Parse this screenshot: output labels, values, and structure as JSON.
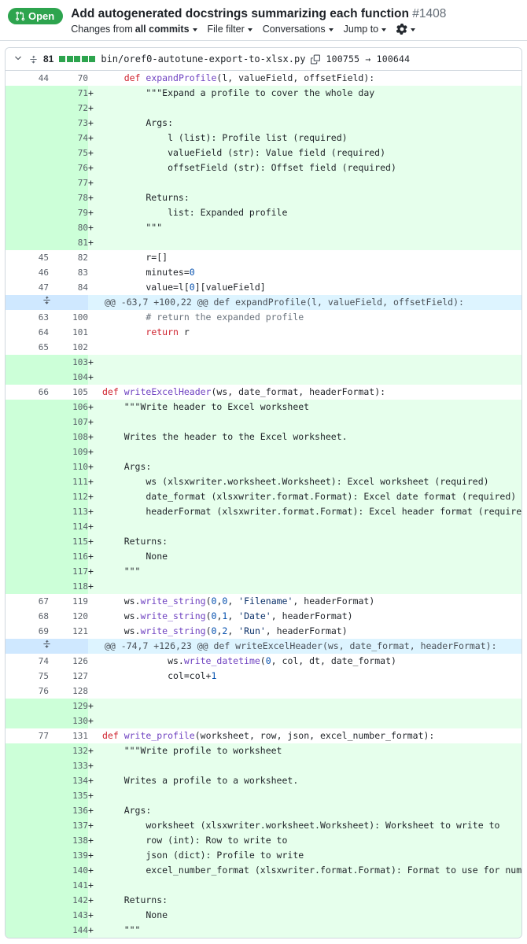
{
  "header": {
    "state_label": "Open",
    "state_icon": "pull-request-icon",
    "state_color": "#2da44e",
    "title": "Add autogenerated docstrings summarizing each function",
    "pr_number": "#1408",
    "toolbar": [
      {
        "label_prefix": "Changes from ",
        "label_strong": "all commits",
        "name": "changes-from-menu"
      },
      {
        "label_prefix": "File filter",
        "label_strong": "",
        "name": "file-filter-menu"
      },
      {
        "label_prefix": "Conversations",
        "label_strong": "",
        "name": "conversations-menu"
      },
      {
        "label_prefix": "Jump to",
        "label_strong": "",
        "name": "jump-to-menu"
      }
    ],
    "settings_icon": "gear-icon"
  },
  "file": {
    "collapse_icon": "chevron-down-icon",
    "expand_icon": "unfold-icon",
    "changes_count": "81",
    "diffstat_blocks": [
      "add",
      "add",
      "add",
      "add",
      "add"
    ],
    "path": "bin/oref0-autotune-export-to-xlsx.py",
    "copy_icon": "copy-icon",
    "mode_change": "100755 → 100644"
  },
  "colors": {
    "addition_bg": "#e6ffec",
    "addition_gutter": "#ccffd8",
    "hunk_bg": "#ddf4ff",
    "hunk_gutter": "#cfe8ff",
    "keyword": "#cf222e",
    "function": "#6f42c1",
    "number": "#0550ae",
    "string": "#0a3069",
    "comment": "#6a737d"
  },
  "diff_rows": [
    {
      "type": "ctx",
      "old": "44",
      "new": "70",
      "mark": "",
      "tokens": [
        {
          "t": "    ",
          "c": ""
        },
        {
          "t": "def ",
          "c": "k"
        },
        {
          "t": "expandProfile",
          "c": "fn"
        },
        {
          "t": "(l, valueField, offsetField):",
          "c": ""
        }
      ]
    },
    {
      "type": "add",
      "old": "",
      "new": "71",
      "mark": "+",
      "tokens": [
        {
          "t": "        \"\"\"Expand a profile to cover the whole day",
          "c": ""
        }
      ]
    },
    {
      "type": "add",
      "old": "",
      "new": "72",
      "mark": "+",
      "tokens": [
        {
          "t": "",
          "c": ""
        }
      ]
    },
    {
      "type": "add",
      "old": "",
      "new": "73",
      "mark": "+",
      "tokens": [
        {
          "t": "        Args:",
          "c": ""
        }
      ]
    },
    {
      "type": "add",
      "old": "",
      "new": "74",
      "mark": "+",
      "tokens": [
        {
          "t": "            l (list): Profile list (required)",
          "c": ""
        }
      ]
    },
    {
      "type": "add",
      "old": "",
      "new": "75",
      "mark": "+",
      "tokens": [
        {
          "t": "            valueField (str): Value field (required)",
          "c": ""
        }
      ]
    },
    {
      "type": "add",
      "old": "",
      "new": "76",
      "mark": "+",
      "tokens": [
        {
          "t": "            offsetField (str): Offset field (required)",
          "c": ""
        }
      ]
    },
    {
      "type": "add",
      "old": "",
      "new": "77",
      "mark": "+",
      "tokens": [
        {
          "t": "",
          "c": ""
        }
      ]
    },
    {
      "type": "add",
      "old": "",
      "new": "78",
      "mark": "+",
      "tokens": [
        {
          "t": "        Returns:",
          "c": ""
        }
      ]
    },
    {
      "type": "add",
      "old": "",
      "new": "79",
      "mark": "+",
      "tokens": [
        {
          "t": "            list: Expanded profile",
          "c": ""
        }
      ]
    },
    {
      "type": "add",
      "old": "",
      "new": "80",
      "mark": "+",
      "tokens": [
        {
          "t": "        \"\"\"",
          "c": ""
        }
      ]
    },
    {
      "type": "add",
      "old": "",
      "new": "81",
      "mark": "+",
      "tokens": [
        {
          "t": "",
          "c": ""
        }
      ]
    },
    {
      "type": "ctx",
      "old": "45",
      "new": "82",
      "mark": "",
      "tokens": [
        {
          "t": "        r=[]",
          "c": ""
        }
      ]
    },
    {
      "type": "ctx",
      "old": "46",
      "new": "83",
      "mark": "",
      "tokens": [
        {
          "t": "        minutes=",
          "c": ""
        },
        {
          "t": "0",
          "c": "n"
        }
      ]
    },
    {
      "type": "ctx",
      "old": "47",
      "new": "84",
      "mark": "",
      "tokens": [
        {
          "t": "        value=l[",
          "c": ""
        },
        {
          "t": "0",
          "c": "n"
        },
        {
          "t": "][valueField]",
          "c": ""
        }
      ]
    },
    {
      "type": "hunk",
      "old": "",
      "new": "",
      "mark": "",
      "tokens": [
        {
          "t": "@@ -63,7 +100,22 @@ def expandProfile(l, valueField, offsetField):",
          "c": ""
        }
      ]
    },
    {
      "type": "ctx",
      "old": "63",
      "new": "100",
      "mark": "",
      "tokens": [
        {
          "t": "        ",
          "c": ""
        },
        {
          "t": "# return the expanded profile",
          "c": "c"
        }
      ]
    },
    {
      "type": "ctx",
      "old": "64",
      "new": "101",
      "mark": "",
      "tokens": [
        {
          "t": "        ",
          "c": ""
        },
        {
          "t": "return",
          "c": "k"
        },
        {
          "t": " r",
          "c": ""
        }
      ]
    },
    {
      "type": "ctx",
      "old": "65",
      "new": "102",
      "mark": "",
      "tokens": [
        {
          "t": "",
          "c": ""
        }
      ]
    },
    {
      "type": "add",
      "old": "",
      "new": "103",
      "mark": "+",
      "tokens": [
        {
          "t": "",
          "c": ""
        }
      ]
    },
    {
      "type": "add",
      "old": "",
      "new": "104",
      "mark": "+",
      "tokens": [
        {
          "t": "",
          "c": ""
        }
      ]
    },
    {
      "type": "ctx",
      "old": "66",
      "new": "105",
      "mark": "",
      "tokens": [
        {
          "t": "def ",
          "c": "k"
        },
        {
          "t": "writeExcelHeader",
          "c": "fn"
        },
        {
          "t": "(ws, date_format, headerFormat):",
          "c": ""
        }
      ]
    },
    {
      "type": "add",
      "old": "",
      "new": "106",
      "mark": "+",
      "tokens": [
        {
          "t": "    \"\"\"Write header to Excel worksheet",
          "c": ""
        }
      ]
    },
    {
      "type": "add",
      "old": "",
      "new": "107",
      "mark": "+",
      "tokens": [
        {
          "t": "",
          "c": ""
        }
      ]
    },
    {
      "type": "add",
      "old": "",
      "new": "108",
      "mark": "+",
      "tokens": [
        {
          "t": "    Writes the header to the Excel worksheet.",
          "c": ""
        }
      ]
    },
    {
      "type": "add",
      "old": "",
      "new": "109",
      "mark": "+",
      "tokens": [
        {
          "t": "",
          "c": ""
        }
      ]
    },
    {
      "type": "add",
      "old": "",
      "new": "110",
      "mark": "+",
      "tokens": [
        {
          "t": "    Args:",
          "c": ""
        }
      ]
    },
    {
      "type": "add",
      "old": "",
      "new": "111",
      "mark": "+",
      "tokens": [
        {
          "t": "        ws (xlsxwriter.worksheet.Worksheet): Excel worksheet (required)",
          "c": ""
        }
      ]
    },
    {
      "type": "add",
      "old": "",
      "new": "112",
      "mark": "+",
      "tokens": [
        {
          "t": "        date_format (xlsxwriter.format.Format): Excel date format (required)",
          "c": ""
        }
      ]
    },
    {
      "type": "add",
      "old": "",
      "new": "113",
      "mark": "+",
      "tokens": [
        {
          "t": "        headerFormat (xlsxwriter.format.Format): Excel header format (required)",
          "c": ""
        }
      ]
    },
    {
      "type": "add",
      "old": "",
      "new": "114",
      "mark": "+",
      "tokens": [
        {
          "t": "",
          "c": ""
        }
      ]
    },
    {
      "type": "add",
      "old": "",
      "new": "115",
      "mark": "+",
      "tokens": [
        {
          "t": "    Returns:",
          "c": ""
        }
      ]
    },
    {
      "type": "add",
      "old": "",
      "new": "116",
      "mark": "+",
      "tokens": [
        {
          "t": "        None",
          "c": ""
        }
      ]
    },
    {
      "type": "add",
      "old": "",
      "new": "117",
      "mark": "+",
      "tokens": [
        {
          "t": "    \"\"\"",
          "c": ""
        }
      ]
    },
    {
      "type": "add",
      "old": "",
      "new": "118",
      "mark": "+",
      "tokens": [
        {
          "t": "",
          "c": ""
        }
      ]
    },
    {
      "type": "ctx",
      "old": "67",
      "new": "119",
      "mark": "",
      "tokens": [
        {
          "t": "    ws.",
          "c": ""
        },
        {
          "t": "write_string",
          "c": "fn"
        },
        {
          "t": "(",
          "c": ""
        },
        {
          "t": "0",
          "c": "n"
        },
        {
          "t": ",",
          "c": ""
        },
        {
          "t": "0",
          "c": "n"
        },
        {
          "t": ", ",
          "c": ""
        },
        {
          "t": "'Filename'",
          "c": "s"
        },
        {
          "t": ", headerFormat)",
          "c": ""
        }
      ]
    },
    {
      "type": "ctx",
      "old": "68",
      "new": "120",
      "mark": "",
      "tokens": [
        {
          "t": "    ws.",
          "c": ""
        },
        {
          "t": "write_string",
          "c": "fn"
        },
        {
          "t": "(",
          "c": ""
        },
        {
          "t": "0",
          "c": "n"
        },
        {
          "t": ",",
          "c": ""
        },
        {
          "t": "1",
          "c": "n"
        },
        {
          "t": ", ",
          "c": ""
        },
        {
          "t": "'Date'",
          "c": "s"
        },
        {
          "t": ", headerFormat)",
          "c": ""
        }
      ]
    },
    {
      "type": "ctx",
      "old": "69",
      "new": "121",
      "mark": "",
      "tokens": [
        {
          "t": "    ws.",
          "c": ""
        },
        {
          "t": "write_string",
          "c": "fn"
        },
        {
          "t": "(",
          "c": ""
        },
        {
          "t": "0",
          "c": "n"
        },
        {
          "t": ",",
          "c": ""
        },
        {
          "t": "2",
          "c": "n"
        },
        {
          "t": ", ",
          "c": ""
        },
        {
          "t": "'Run'",
          "c": "s"
        },
        {
          "t": ", headerFormat)",
          "c": ""
        }
      ]
    },
    {
      "type": "hunk",
      "old": "",
      "new": "",
      "mark": "",
      "tokens": [
        {
          "t": "@@ -74,7 +126,23 @@ def writeExcelHeader(ws, date_format, headerFormat):",
          "c": ""
        }
      ]
    },
    {
      "type": "ctx",
      "old": "74",
      "new": "126",
      "mark": "",
      "tokens": [
        {
          "t": "            ws.",
          "c": ""
        },
        {
          "t": "write_datetime",
          "c": "fn"
        },
        {
          "t": "(",
          "c": ""
        },
        {
          "t": "0",
          "c": "n"
        },
        {
          "t": ", col, dt, date_format)",
          "c": ""
        }
      ]
    },
    {
      "type": "ctx",
      "old": "75",
      "new": "127",
      "mark": "",
      "tokens": [
        {
          "t": "            col=col+",
          "c": ""
        },
        {
          "t": "1",
          "c": "n"
        }
      ]
    },
    {
      "type": "ctx",
      "old": "76",
      "new": "128",
      "mark": "",
      "tokens": [
        {
          "t": "",
          "c": ""
        }
      ]
    },
    {
      "type": "add",
      "old": "",
      "new": "129",
      "mark": "+",
      "tokens": [
        {
          "t": "",
          "c": ""
        }
      ]
    },
    {
      "type": "add",
      "old": "",
      "new": "130",
      "mark": "+",
      "tokens": [
        {
          "t": "",
          "c": ""
        }
      ]
    },
    {
      "type": "ctx",
      "old": "77",
      "new": "131",
      "mark": "",
      "tokens": [
        {
          "t": "def ",
          "c": "k"
        },
        {
          "t": "write_profile",
          "c": "fn"
        },
        {
          "t": "(worksheet, row, json, excel_number_format):",
          "c": ""
        }
      ]
    },
    {
      "type": "add",
      "old": "",
      "new": "132",
      "mark": "+",
      "tokens": [
        {
          "t": "    \"\"\"Write profile to worksheet",
          "c": ""
        }
      ]
    },
    {
      "type": "add",
      "old": "",
      "new": "133",
      "mark": "+",
      "tokens": [
        {
          "t": "",
          "c": ""
        }
      ]
    },
    {
      "type": "add",
      "old": "",
      "new": "134",
      "mark": "+",
      "tokens": [
        {
          "t": "    Writes a profile to a worksheet.",
          "c": ""
        }
      ]
    },
    {
      "type": "add",
      "old": "",
      "new": "135",
      "mark": "+",
      "tokens": [
        {
          "t": "",
          "c": ""
        }
      ]
    },
    {
      "type": "add",
      "old": "",
      "new": "136",
      "mark": "+",
      "tokens": [
        {
          "t": "    Args:",
          "c": ""
        }
      ]
    },
    {
      "type": "add",
      "old": "",
      "new": "137",
      "mark": "+",
      "tokens": [
        {
          "t": "        worksheet (xlsxwriter.worksheet.Worksheet): Worksheet to write to",
          "c": ""
        }
      ]
    },
    {
      "type": "add",
      "old": "",
      "new": "138",
      "mark": "+",
      "tokens": [
        {
          "t": "        row (int): Row to write to",
          "c": ""
        }
      ]
    },
    {
      "type": "add",
      "old": "",
      "new": "139",
      "mark": "+",
      "tokens": [
        {
          "t": "        json (dict): Profile to write",
          "c": ""
        }
      ]
    },
    {
      "type": "add",
      "old": "",
      "new": "140",
      "mark": "+",
      "tokens": [
        {
          "t": "        excel_number_format (xlsxwriter.format.Format): Format to use for numbers",
          "c": ""
        }
      ]
    },
    {
      "type": "add",
      "old": "",
      "new": "141",
      "mark": "+",
      "tokens": [
        {
          "t": "",
          "c": ""
        }
      ]
    },
    {
      "type": "add",
      "old": "",
      "new": "142",
      "mark": "+",
      "tokens": [
        {
          "t": "    Returns:",
          "c": ""
        }
      ]
    },
    {
      "type": "add",
      "old": "",
      "new": "143",
      "mark": "+",
      "tokens": [
        {
          "t": "        None",
          "c": ""
        }
      ]
    },
    {
      "type": "add",
      "old": "",
      "new": "144",
      "mark": "+",
      "tokens": [
        {
          "t": "    \"\"\"",
          "c": ""
        }
      ]
    }
  ]
}
